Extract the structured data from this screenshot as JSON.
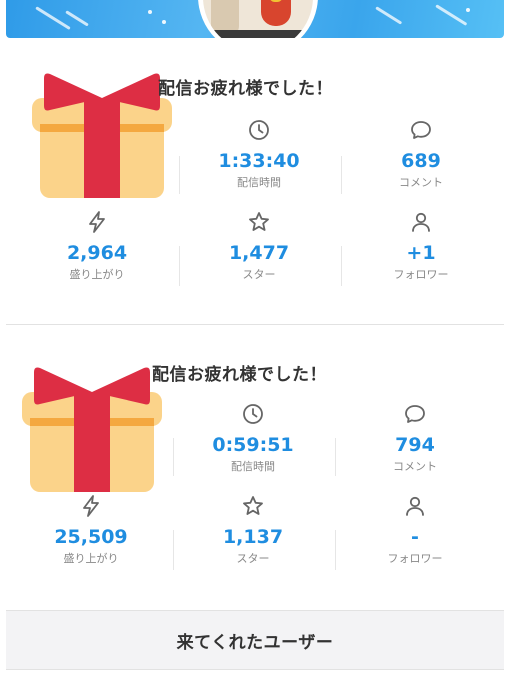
{
  "cards": [
    {
      "title": "配信お疲れ様でした！",
      "stats": [
        {
          "icon": "clock-icon",
          "value": "1:33:40",
          "label": "配信時間"
        },
        {
          "icon": "comment-icon",
          "value": "689",
          "label": "コメント"
        },
        {
          "icon": "lightning-icon",
          "value": "2,964",
          "label": "盛り上がり"
        },
        {
          "icon": "star-icon",
          "value": "1,477",
          "label": "スター"
        },
        {
          "icon": "user-icon",
          "value": "+1",
          "label": "フォロワー"
        }
      ]
    },
    {
      "title": "配信お疲れ様でした！",
      "stats": [
        {
          "icon": "clock-icon",
          "value": "0:59:51",
          "label": "配信時間"
        },
        {
          "icon": "comment-icon",
          "value": "794",
          "label": "コメント"
        },
        {
          "icon": "lightning-icon",
          "value": "25,509",
          "label": "盛り上がり"
        },
        {
          "icon": "star-icon",
          "value": "1,137",
          "label": "スター"
        },
        {
          "icon": "user-icon",
          "value": "-",
          "label": "フォロワー"
        }
      ]
    }
  ],
  "footer": {
    "label": "来てくれたユーザー"
  },
  "colors": {
    "accent": "#1f8de0",
    "banner": "#3aa5ec",
    "gift_box": "#fbd38a",
    "gift_ribbon": "#dd2e44"
  }
}
